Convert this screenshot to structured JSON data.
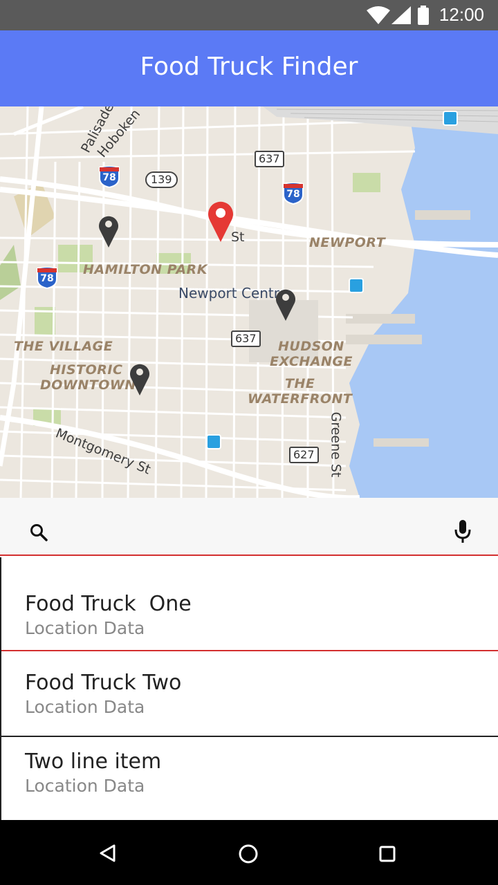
{
  "status_bar": {
    "time": "12:00"
  },
  "app_bar": {
    "title": "Food Truck Finder"
  },
  "map": {
    "area_labels": [
      "HAMILTON PARK",
      "NEWPORT",
      "THE VILLAGE",
      "HISTORIC",
      "DOWNTOWN",
      "HUDSON",
      "EXCHANGE",
      "THE",
      "WATERFRONT"
    ],
    "street_labels": [
      "Palisade",
      "Hoboken",
      "Montgomery St",
      "Greene St",
      "St"
    ],
    "poi_label": "Newport Centre",
    "route_shields": [
      "637",
      "139",
      "637",
      "627"
    ],
    "interstates": [
      "78",
      "78",
      "78"
    ],
    "selected_pin_color": "#e53935",
    "pin_color": "#3d3d3d"
  },
  "search": {
    "placeholder": ""
  },
  "list": {
    "items": [
      {
        "primary": "Food Truck  One",
        "secondary": "Location Data"
      },
      {
        "primary": "Food Truck Two",
        "secondary": "Location Data"
      },
      {
        "primary": "Two line item",
        "secondary": "Location Data"
      }
    ]
  },
  "colors": {
    "app_bar": "#5b7af5",
    "accent": "#d32f2f",
    "water": "#a8c8f5"
  }
}
